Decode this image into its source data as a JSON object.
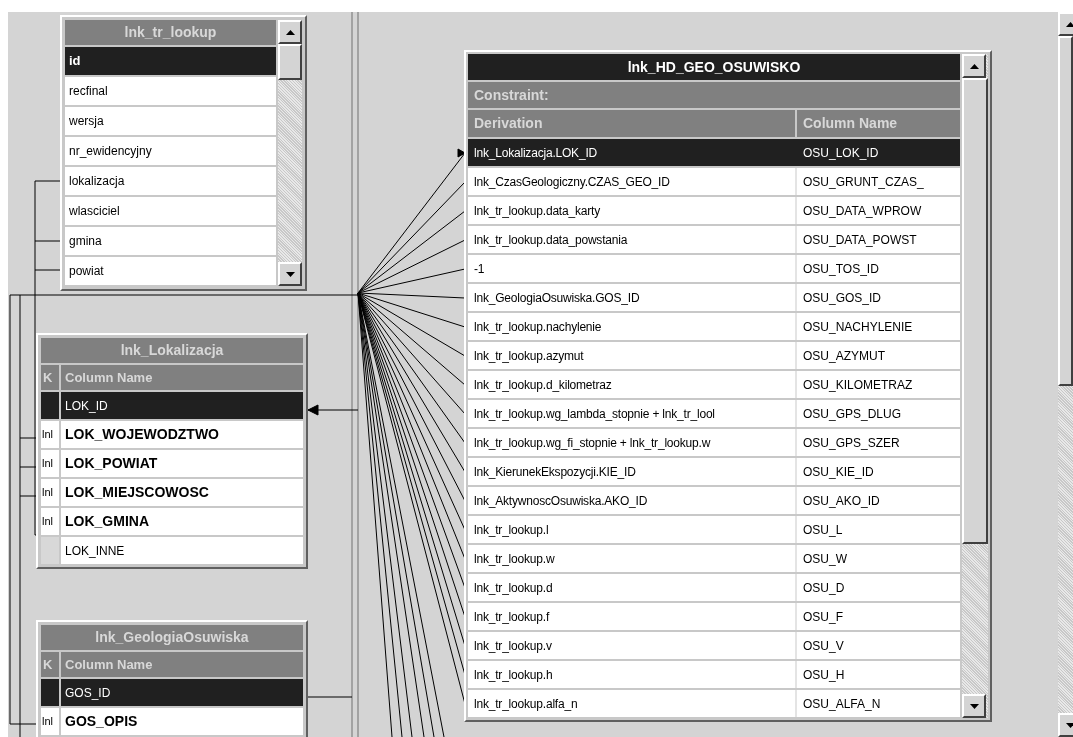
{
  "tables": [
    {
      "title": "lnk_tr_lookup",
      "kind": "plain",
      "rows": [
        {
          "name": "id",
          "selected": true
        },
        {
          "name": "recfinal",
          "selected": false
        },
        {
          "name": "wersja",
          "selected": false
        },
        {
          "name": "nr_ewidencyjny",
          "selected": false
        },
        {
          "name": "lokalizacja",
          "selected": false
        },
        {
          "name": "wlasciciel",
          "selected": false
        },
        {
          "name": "gmina",
          "selected": false
        },
        {
          "name": "powiat",
          "selected": false
        }
      ]
    },
    {
      "title": "lnk_Lokalizacja",
      "kind": "keyed",
      "columns": [
        "K",
        "Column Name"
      ],
      "rows": [
        {
          "name": "LOK_ID",
          "selected": true,
          "bold": false
        },
        {
          "key": "lnl",
          "name": "LOK_WOJEWODZTWO",
          "selected": false,
          "bold": true
        },
        {
          "key": "lnl",
          "name": "LOK_POWIAT",
          "selected": false,
          "bold": true
        },
        {
          "key": "lnl",
          "name": "LOK_MIEJSCOWOSC",
          "selected": false,
          "bold": true
        },
        {
          "key": "lnl",
          "name": "LOK_GMINA",
          "selected": false,
          "bold": true
        },
        {
          "name": "LOK_INNE",
          "selected": false,
          "bold": false
        }
      ]
    },
    {
      "title": "lnk_GeologiaOsuwiska",
      "kind": "keyed",
      "columns": [
        "K",
        "Column Name"
      ],
      "rows": [
        {
          "name": "GOS_ID",
          "selected": true,
          "bold": false
        },
        {
          "key": "lnl",
          "name": "GOS_OPIS",
          "selected": false,
          "bold": true
        }
      ]
    }
  ],
  "main_table": {
    "title": "lnk_HD_GEO_OSUWISKO",
    "constraint": "Constraint:",
    "columns": [
      "Derivation",
      "Column Name"
    ],
    "rows": [
      {
        "derivation": "lnk_Lokalizacja.LOK_ID",
        "column": "OSU_LOK_ID",
        "selected": true
      },
      {
        "derivation": "lnk_CzasGeologiczny.CZAS_GEO_ID",
        "column": "OSU_GRUNT_CZAS_",
        "selected": false
      },
      {
        "derivation": "lnk_tr_lookup.data_karty",
        "column": "OSU_DATA_WPROW",
        "selected": false
      },
      {
        "derivation": "lnk_tr_lookup.data_powstania",
        "column": "OSU_DATA_POWST",
        "selected": false
      },
      {
        "derivation": "-1",
        "column": "OSU_TOS_ID",
        "selected": false
      },
      {
        "derivation": "lnk_GeologiaOsuwiska.GOS_ID",
        "column": "OSU_GOS_ID",
        "selected": false
      },
      {
        "derivation": "lnk_tr_lookup.nachylenie",
        "column": "OSU_NACHYLENIE",
        "selected": false
      },
      {
        "derivation": "lnk_tr_lookup.azymut",
        "column": "OSU_AZYMUT",
        "selected": false
      },
      {
        "derivation": "lnk_tr_lookup.d_kilometraz",
        "column": "OSU_KILOMETRAZ",
        "selected": false
      },
      {
        "derivation": "lnk_tr_lookup.wg_lambda_stopnie + lnk_tr_lool",
        "column": "OSU_GPS_DLUG",
        "selected": false
      },
      {
        "derivation": "lnk_tr_lookup.wg_fi_stopnie + lnk_tr_lookup.w",
        "column": "OSU_GPS_SZER",
        "selected": false
      },
      {
        "derivation": "lnk_KierunekEkspozycji.KIE_ID",
        "column": "OSU_KIE_ID",
        "selected": false
      },
      {
        "derivation": "lnk_AktywnoscOsuwiska.AKO_ID",
        "column": "OSU_AKO_ID",
        "selected": false
      },
      {
        "derivation": "lnk_tr_lookup.l",
        "column": "OSU_L",
        "selected": false
      },
      {
        "derivation": "lnk_tr_lookup.w",
        "column": "OSU_W",
        "selected": false
      },
      {
        "derivation": "lnk_tr_lookup.d",
        "column": "OSU_D",
        "selected": false
      },
      {
        "derivation": "lnk_tr_lookup.f",
        "column": "OSU_F",
        "selected": false
      },
      {
        "derivation": "lnk_tr_lookup.v",
        "column": "OSU_V",
        "selected": false
      },
      {
        "derivation": "lnk_tr_lookup.h",
        "column": "OSU_H",
        "selected": false
      },
      {
        "derivation": "lnk_tr_lookup.alfa_n",
        "column": "OSU_ALFA_N",
        "selected": false
      }
    ]
  }
}
